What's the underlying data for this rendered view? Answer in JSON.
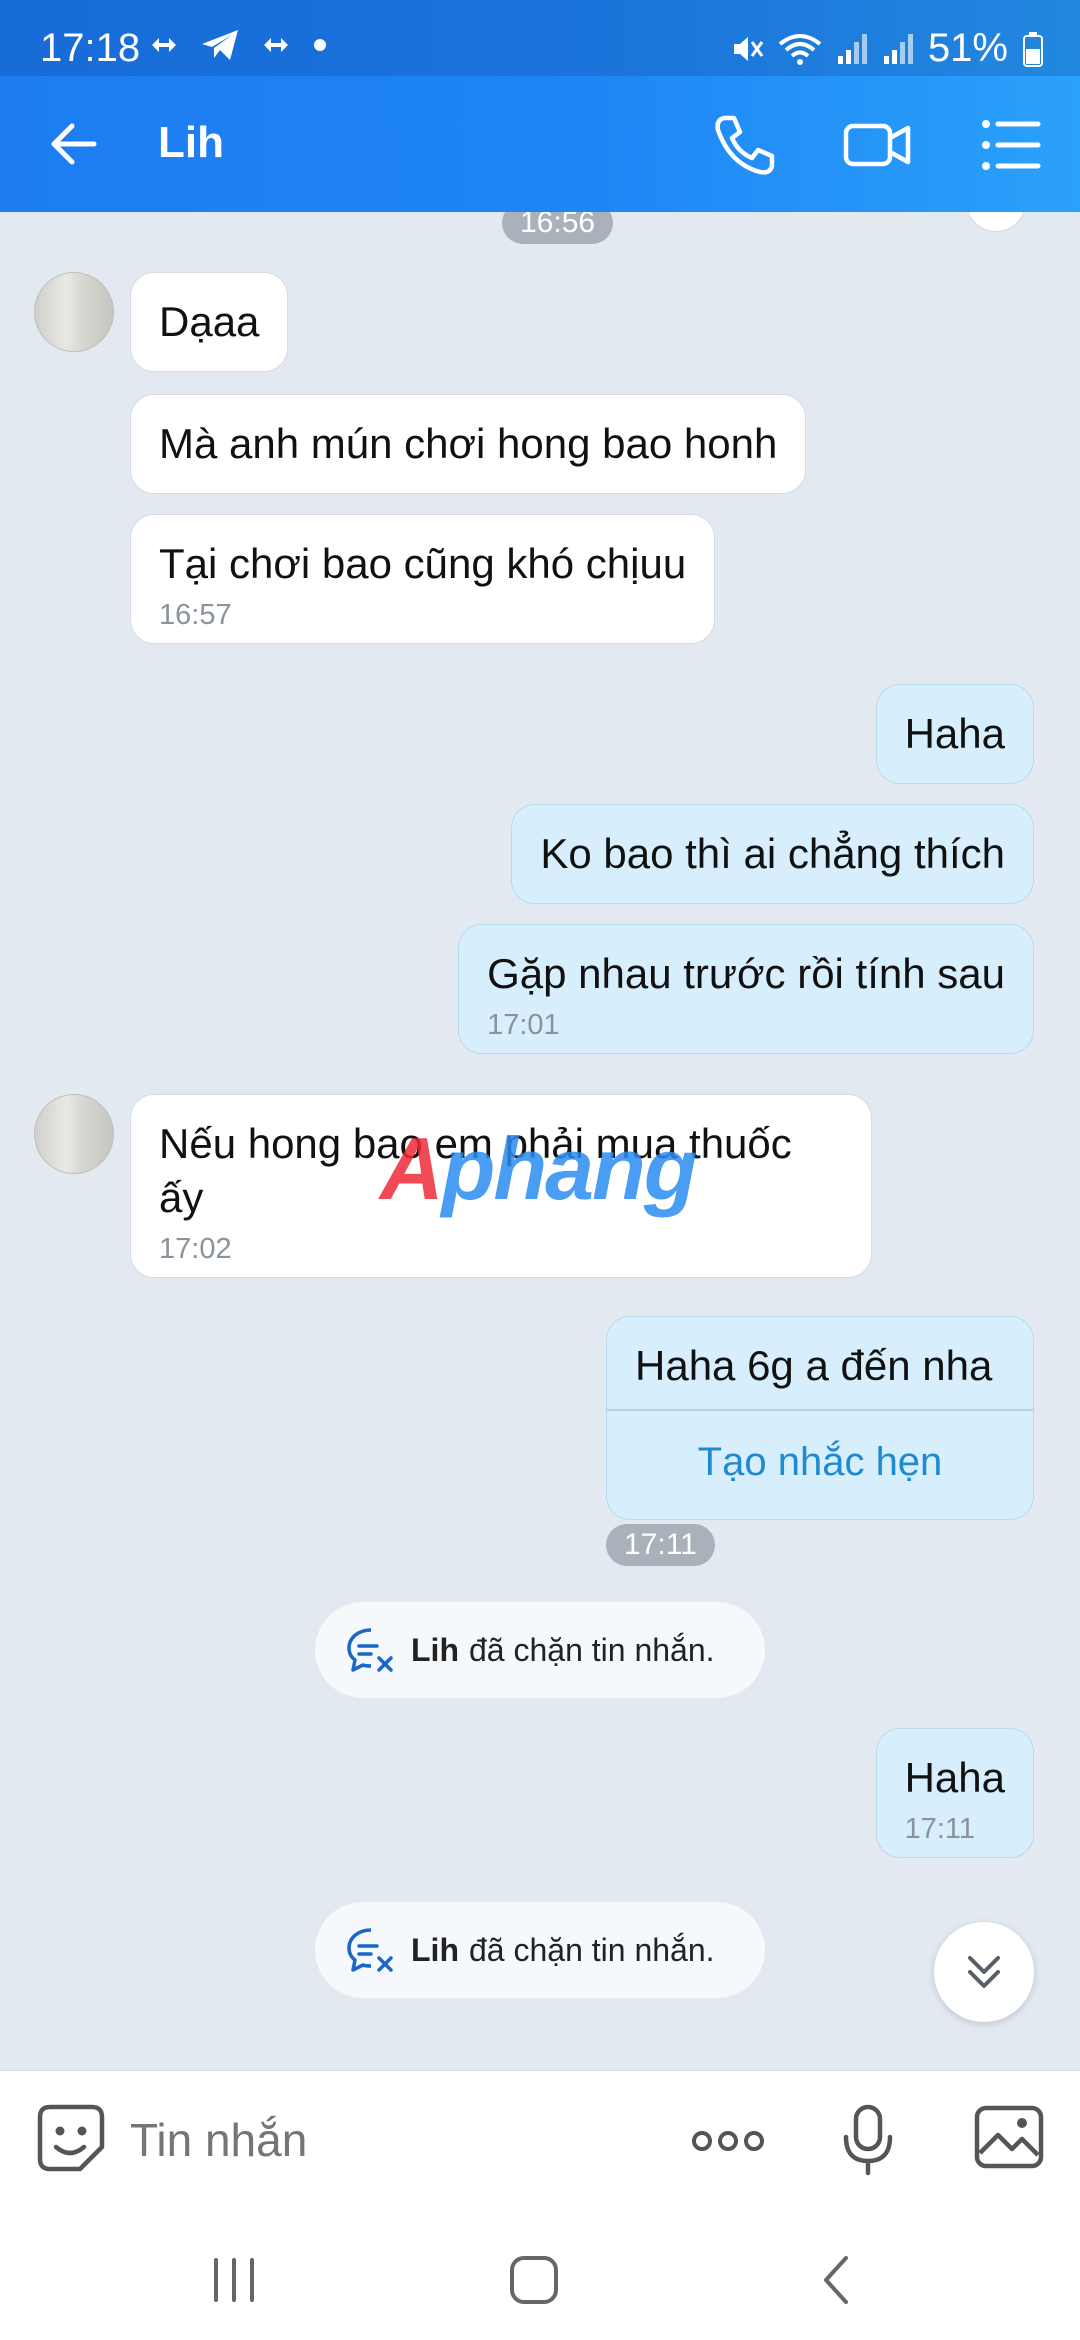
{
  "status_bar": {
    "time": "17:18",
    "battery": "51%"
  },
  "header": {
    "contact_name": "Lih"
  },
  "watermark": {
    "part1": "A",
    "part2": "phang"
  },
  "chat": {
    "time_pill_top": "16:56",
    "messages_in_1": [
      {
        "text": "Dạaa"
      },
      {
        "text": "Mà anh mún chơi hong bao honh"
      },
      {
        "text": "Tại chơi bao cũng khó chịuu",
        "time": "16:57"
      }
    ],
    "messages_out_1": [
      {
        "text": "Haha"
      },
      {
        "text": "Ko bao thì ai chẳng thích"
      },
      {
        "text": "Gặp nhau trước rồi tính sau",
        "time": "17:01"
      }
    ],
    "message_in_2": {
      "text": "Nếu hong bao em phải mua thuốc ấy",
      "time": "17:02"
    },
    "message_out_reminder": {
      "text": "Haha 6g a đến nha",
      "action": "Tạo nhắc hẹn"
    },
    "time_pill_mid": "17:11",
    "system_notice_1": {
      "name": "Lih",
      "text": "đã chặn tin nhắn."
    },
    "message_out_last": {
      "text": "Haha",
      "time": "17:11"
    },
    "system_notice_2": {
      "name": "Lih",
      "text": "đã chặn tin nhắn."
    }
  },
  "input": {
    "placeholder": "Tin nhắn"
  },
  "icons": {
    "back": "arrow-left-icon",
    "call": "phone-icon",
    "video": "video-camera-icon",
    "menu": "list-icon",
    "emoji": "sticker-icon",
    "more": "more-dots-icon",
    "mic": "microphone-icon",
    "gallery": "image-icon",
    "scroll": "chevron-double-down-icon",
    "blocked": "blocked-chat-icon"
  },
  "colors": {
    "header_start": "#1d7cf2",
    "header_end": "#2aa1fb",
    "bubble_out": "#d7effd",
    "bubble_in": "#ffffff",
    "chat_bg": "#e2e9f1",
    "link": "#1f8ad0"
  }
}
